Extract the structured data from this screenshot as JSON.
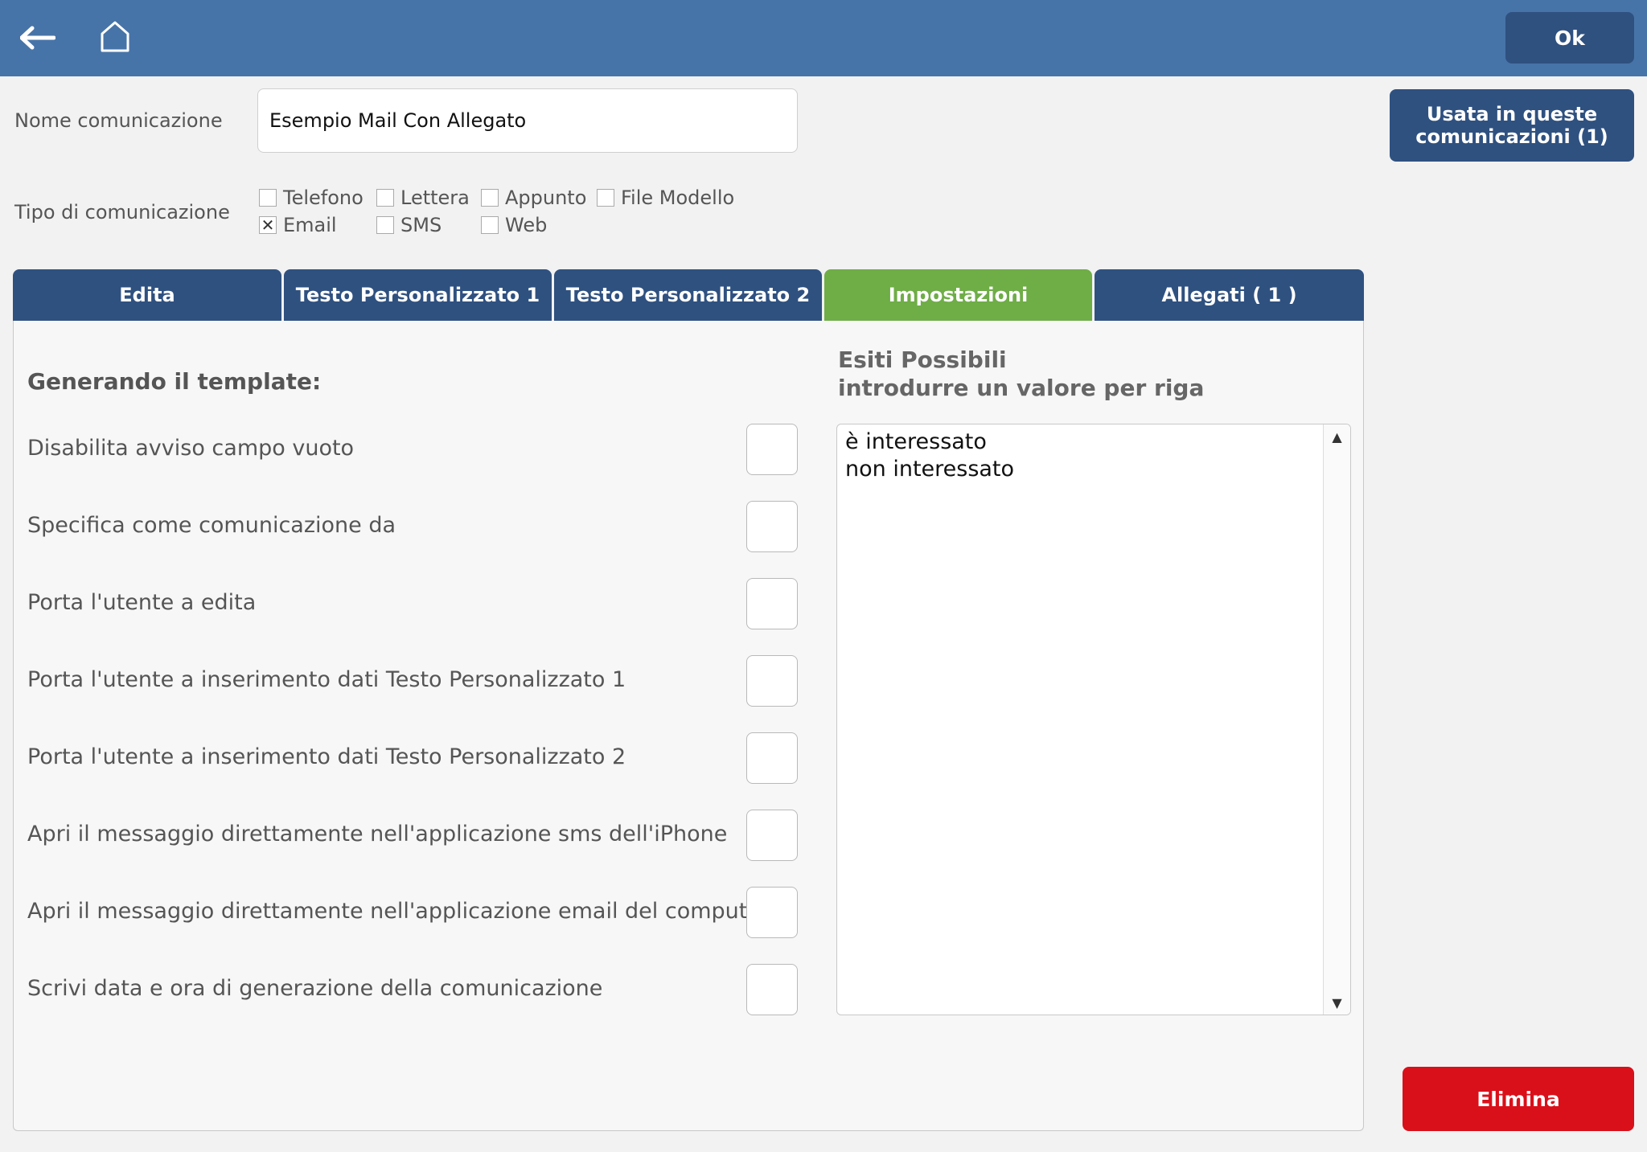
{
  "toolbar": {
    "back_icon": "arrow-left-icon",
    "home_icon": "home-icon",
    "ok_label": "Ok"
  },
  "form": {
    "name_label": "Nome comunicazione",
    "name_value": "Esempio Mail Con Allegato",
    "used_button_line1": "Usata in queste",
    "used_button_line2": "comunicazioni (1)",
    "type_label": "Tipo di comunicazione",
    "types": [
      {
        "label": "Telefono",
        "checked": false
      },
      {
        "label": "Lettera",
        "checked": false
      },
      {
        "label": "Appunto",
        "checked": false
      },
      {
        "label": "File Modello",
        "checked": false
      },
      {
        "label": "Email",
        "checked": true
      },
      {
        "label": "SMS",
        "checked": false
      },
      {
        "label": "Web",
        "checked": false
      }
    ]
  },
  "tabs": [
    {
      "label": "Edita",
      "active": false
    },
    {
      "label": "Testo Personalizzato 1",
      "active": false
    },
    {
      "label": "Testo Personalizzato 2",
      "active": false
    },
    {
      "label": "Impostazioni",
      "active": true
    },
    {
      "label": "Allegati ( 1 )",
      "active": false
    }
  ],
  "settings": {
    "title": "Generando il template:",
    "options": [
      "Disabilita avviso campo vuoto",
      "Specifica come comunicazione da",
      "Porta l'utente a edita",
      "Porta l'utente a inserimento dati Testo Personalizzato 1",
      "Porta l'utente a inserimento dati Testo Personalizzato 2",
      "Apri il messaggio direttamente nell'applicazione sms dell'iPhone",
      "Apri il messaggio direttamente nell'applicazione email del computer",
      "Scrivi data e ora di generazione della comunicazione"
    ]
  },
  "esiti": {
    "title_line1": "Esiti Possibili",
    "title_line2": "introdurre un valore per riga",
    "values": [
      "è interessato",
      "non interessato"
    ],
    "scroll_up_icon": "▲",
    "scroll_down_icon": "▼"
  },
  "footer": {
    "delete_label": "Elimina"
  },
  "colors": {
    "topbar": "#4774a8",
    "button_dark": "#2f5180",
    "tab_active": "#6fad47",
    "delete": "#d9101a"
  }
}
